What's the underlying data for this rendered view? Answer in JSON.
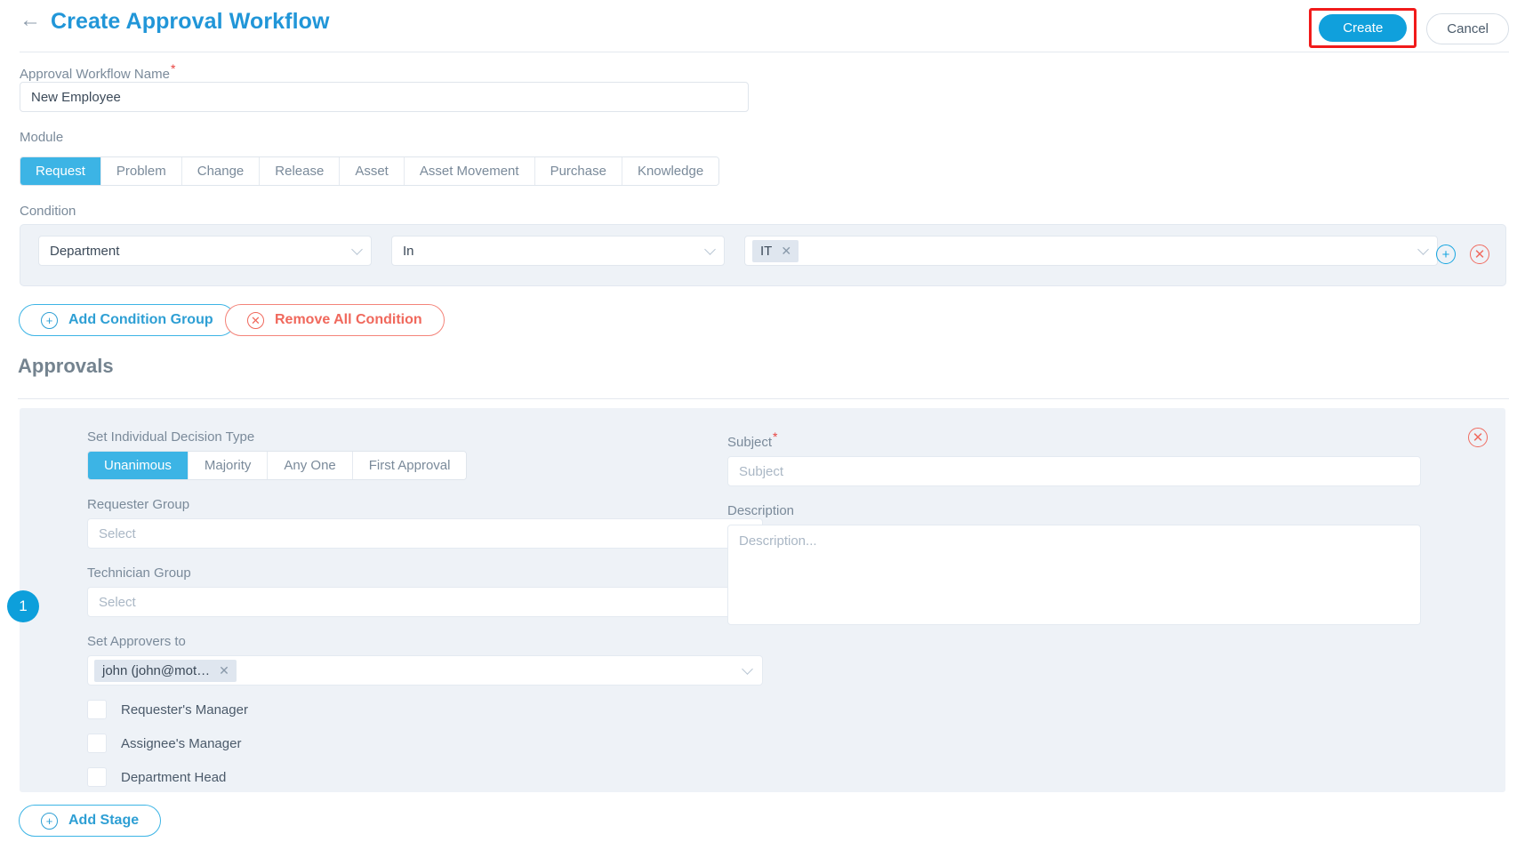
{
  "header": {
    "back_icon": "arrow-left-icon",
    "title": "Create Approval Workflow",
    "create_label": "Create",
    "cancel_label": "Cancel",
    "create_highlight_color": "#f11b1b",
    "accent_color": "#2196d8"
  },
  "workflow_name": {
    "label": "Approval Workflow Name",
    "required_mark": "*",
    "value": "New Employee"
  },
  "module": {
    "label": "Module",
    "tabs": [
      {
        "label": "Request",
        "active": true
      },
      {
        "label": "Problem",
        "active": false
      },
      {
        "label": "Change",
        "active": false
      },
      {
        "label": "Release",
        "active": false
      },
      {
        "label": "Asset",
        "active": false
      },
      {
        "label": "Asset Movement",
        "active": false
      },
      {
        "label": "Purchase",
        "active": false
      },
      {
        "label": "Knowledge",
        "active": false
      }
    ]
  },
  "condition": {
    "label": "Condition",
    "field_value": "Department",
    "operator_value": "In",
    "value_chips": [
      {
        "label": "IT",
        "remove_icon": "close-icon"
      }
    ],
    "add_icon": "plus-circle-icon",
    "remove_icon": "close-circle-icon",
    "add_group_label": "Add Condition Group",
    "remove_all_label": "Remove All Condition"
  },
  "approvals": {
    "title": "Approvals",
    "add_stage_label": "Add Stage",
    "stage": {
      "number": "1",
      "delete_icon": "close-circle-icon",
      "decision_type": {
        "label": "Set Individual Decision Type",
        "options": [
          {
            "label": "Unanimous",
            "active": true
          },
          {
            "label": "Majority",
            "active": false
          },
          {
            "label": "Any One",
            "active": false
          },
          {
            "label": "First Approval",
            "active": false
          }
        ]
      },
      "requester_group": {
        "label": "Requester Group",
        "placeholder": "Select",
        "value": ""
      },
      "technician_group": {
        "label": "Technician Group",
        "placeholder": "Select",
        "value": ""
      },
      "set_approvers": {
        "label": "Set Approvers to",
        "chips": [
          {
            "label": "john (john@mot…",
            "remove_icon": "close-icon"
          }
        ]
      },
      "checkboxes": [
        {
          "label": "Requester's Manager",
          "checked": false
        },
        {
          "label": "Assignee's Manager",
          "checked": false
        },
        {
          "label": "Department Head",
          "checked": false
        }
      ],
      "subject": {
        "label": "Subject",
        "required_mark": "*",
        "placeholder": "Subject",
        "value": ""
      },
      "description": {
        "label": "Description",
        "placeholder": "Description...",
        "value": ""
      }
    }
  }
}
